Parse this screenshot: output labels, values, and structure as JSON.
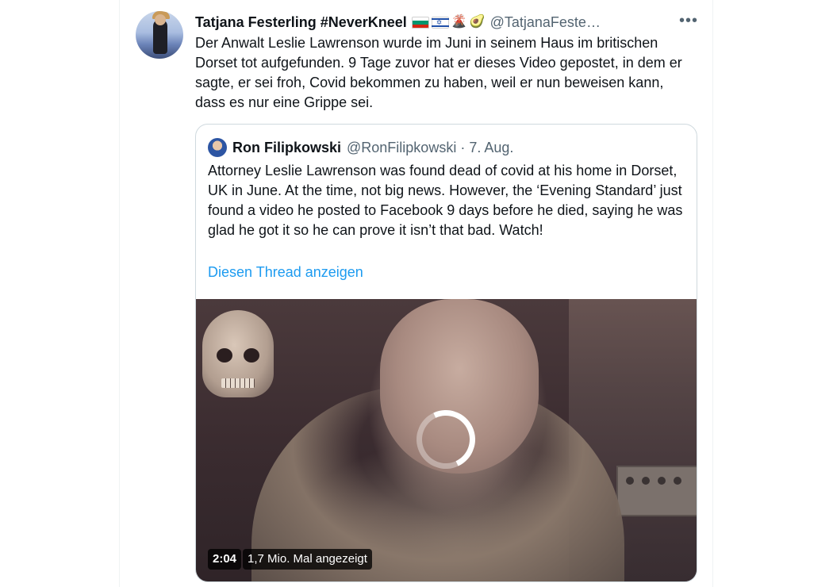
{
  "tweet": {
    "display_name": "Tatjana Festerling #NeverKneel",
    "handle": "@TatjanaFeste…",
    "emojis": [
      "flag-bulgaria-icon",
      "flag-israel-icon",
      "volcano-icon",
      "avocado-icon"
    ],
    "more_label": "•••",
    "text": "Der Anwalt Leslie Lawrenson wurde im Juni in seinem Haus im britischen Dorset tot aufgefunden. 9 Tage zuvor hat er dieses Video gepostet, in dem er sagte, er sei froh, Covid bekommen zu haben, weil er nun beweisen kann, dass es nur eine Grippe sei."
  },
  "quote": {
    "display_name": "Ron Filipkowski",
    "handle_date": "@RonFilipkowski · 7. Aug.",
    "text": "Attorney Leslie Lawrenson was found dead of covid at his home in Dorset, UK in June. At the time, not big news. However, the ‘Evening Standard’ just found a video he posted to Facebook 9 days before he died, saying he was glad he got it so he can prove it isn’t that bad. Watch!",
    "thread_link": "Diesen Thread anzeigen",
    "video": {
      "duration": "2:04",
      "views": "1,7 Mio. Mal angezeigt"
    }
  },
  "colors": {
    "link": "#1d9bf0",
    "secondary_text": "#536471",
    "border": "#cfd9de"
  }
}
